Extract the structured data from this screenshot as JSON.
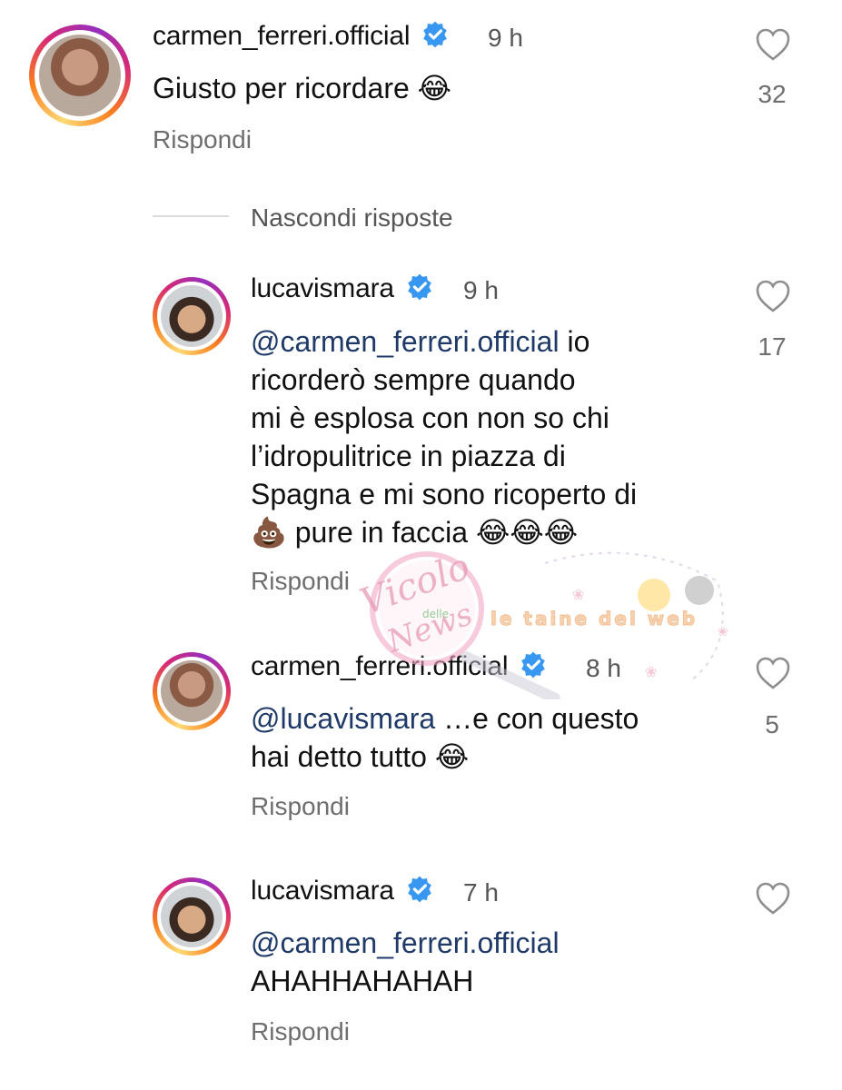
{
  "comments": [
    {
      "username": "carmen_ferreri.official",
      "time": "9 h",
      "text": "Giusto per ricordare 😂",
      "reply_label": "Rispondi",
      "likes": "32"
    },
    {
      "username": "lucavismara",
      "time": "9 h",
      "mention": "@carmen_ferreri.official",
      "text_line1": " io",
      "text_line2": "ricorderò sempre quando",
      "text_line3": "mi è esplosa con non so chi",
      "text_line4": "l’idropulitrice in piazza di",
      "text_line5": "Spagna e mi sono ricoperto di",
      "text_line6": "💩 pure in faccia 😂😂😂",
      "reply_label": "Rispondi",
      "likes": "17"
    },
    {
      "username": "carmen_ferreri.official",
      "time": "8 h",
      "mention": "@lucavismara",
      "text_line1": " …e con questo",
      "text_line2": "hai detto tutto 😂",
      "reply_label": "Rispondi",
      "likes": "5"
    },
    {
      "username": "lucavismara",
      "time": "7 h",
      "mention": "@carmen_ferreri.official",
      "text_line2": "AHAHHAHAHAH",
      "reply_label": "Rispondi",
      "likes": ""
    }
  ],
  "hide_replies_label": "Nascondi risposte",
  "watermark": {
    "text1": "Vicolo delle News",
    "text2": "le taine del web"
  },
  "colors": {
    "mention": "#1f3a68",
    "verified": "#3897f0",
    "meta": "#6e6e6e"
  },
  "icons": [
    "verified-badge-icon",
    "heart-icon"
  ]
}
